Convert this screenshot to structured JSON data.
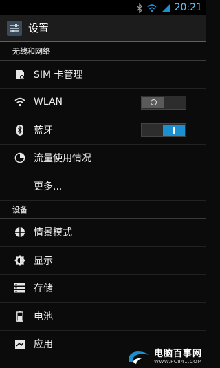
{
  "statusbar": {
    "time": "20:21",
    "icons": [
      "bluetooth-icon",
      "wifi-icon",
      "signal-icon"
    ]
  },
  "actionbar": {
    "title": "设置"
  },
  "sections": [
    {
      "header": "无线和网络"
    },
    {
      "header": "设备"
    }
  ],
  "items": {
    "sim": {
      "label": "SIM 卡管理"
    },
    "wlan": {
      "label": "WLAN",
      "toggle": "off"
    },
    "bluetooth": {
      "label": "蓝牙",
      "toggle": "on"
    },
    "data_usage": {
      "label": "流量使用情况"
    },
    "more": {
      "label": "更多..."
    },
    "profiles": {
      "label": "情景模式"
    },
    "display": {
      "label": "显示"
    },
    "storage": {
      "label": "存储"
    },
    "battery": {
      "label": "电池"
    },
    "apps": {
      "label": "应用"
    }
  },
  "watermark": {
    "main": "电脑百事网",
    "url": "WWW.PC841.COM"
  },
  "colors": {
    "accent": "#1b8fcf",
    "time": "#5fc8ff",
    "background": "#0b0b0b"
  }
}
